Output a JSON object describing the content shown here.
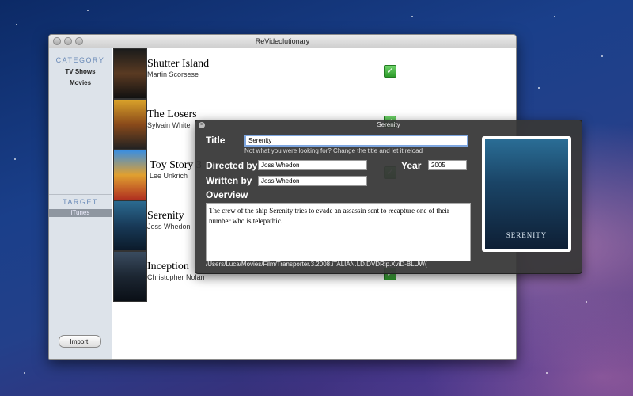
{
  "window": {
    "title": "ReVideolutionary"
  },
  "sidebar": {
    "category_heading": "CATEGORY",
    "items": [
      {
        "label": "TV Shows"
      },
      {
        "label": "Movies"
      }
    ],
    "target_heading": "TARGET",
    "target_item": "iTunes",
    "import_label": "Import!"
  },
  "movies": [
    {
      "title": "Shutter Island",
      "director": "Martin Scorsese",
      "checked": true,
      "poster_color": "#3a2a1a"
    },
    {
      "title": "The Losers",
      "director": "Sylvain White",
      "checked": true,
      "poster_color": "#c28a20"
    },
    {
      "title": "Toy Story 3",
      "director": "Lee Unkrich",
      "checked": true,
      "poster_color": "#2f7bd0"
    },
    {
      "title": "Serenity",
      "director": "Joss Whedon",
      "checked": true,
      "poster_color": "#1d4a6e"
    },
    {
      "title": "Inception",
      "director": "Christopher Nolan",
      "checked": true,
      "poster_color": "#223344"
    }
  ],
  "hud": {
    "title": "Serenity",
    "title_label": "Title",
    "title_value": "Serenity",
    "hint": "Not what you were looking for? Change the title and let it reload",
    "directed_label": "Directed by",
    "directed_value": "Joss Whedon",
    "year_label": "Year",
    "year_value": "2005",
    "written_label": "Written by",
    "written_value": "Joss Whedon",
    "overview_label": "Overview",
    "overview_text": "The crew of the ship Serenity tries to evade an assassin sent to recapture one of their number who is telepathic.",
    "path": "/Users/Luca/Movies/Film/Transporter.3.2008.iTALIAN.LD.DVDRip.XviD-BLUW(",
    "poster_caption": "SERENITY"
  }
}
